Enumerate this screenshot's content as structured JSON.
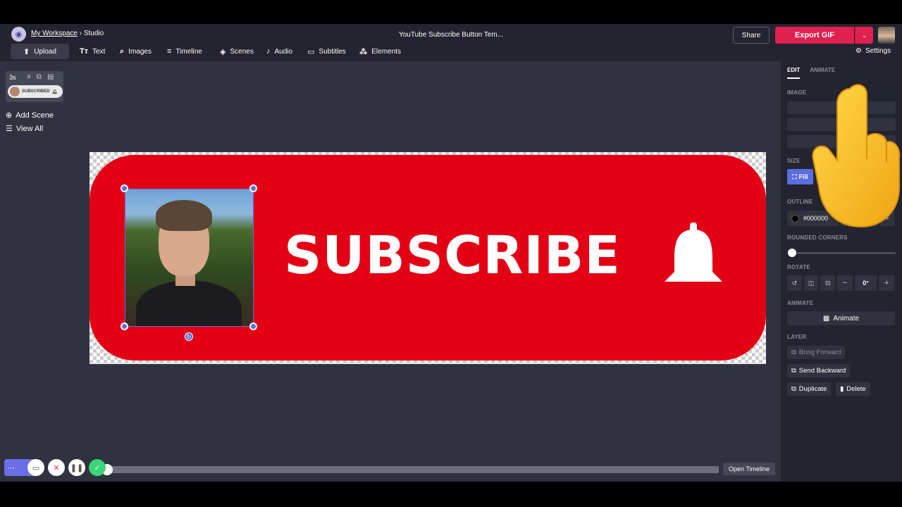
{
  "header": {
    "workspace_link": "My Workspace",
    "separator": "›",
    "section": "Studio",
    "doc_title": "YouTube Subscribe Button Tem...",
    "share_label": "Share",
    "export_label": "Export GIF",
    "export_caret": "⌄"
  },
  "toolbar": {
    "upload": "Upload",
    "text": "Text",
    "images": "Images",
    "timeline": "Timeline",
    "scenes": "Scenes",
    "audio": "Audio",
    "subtitles": "Subtitles",
    "elements": "Elements",
    "settings": "Settings"
  },
  "scenes": {
    "duration": "3s",
    "thumb_label": "SUBSCRIBED",
    "add_scene": "Add Scene",
    "view_all": "View All"
  },
  "canvas": {
    "subscribe_text": "SUBSCRIBE"
  },
  "bottom": {
    "open_timeline": "Open Timeline",
    "progress": 0.0
  },
  "panel": {
    "tab_edit": "EDIT",
    "tab_animate": "ANIMATE",
    "image_label": "IMAGE",
    "size_label": "SIZE",
    "fill_label": "Fill",
    "outline_label": "OUTLINE",
    "outline_color": "#000000",
    "outline_width": "0",
    "rounded_label": "ROUNDED CORNERS",
    "rounded_value": 0,
    "rotate_label": "ROTATE",
    "rotate_value": "0°",
    "animate_section": "ANIMATE",
    "animate_btn": "Animate",
    "layer_label": "LAYER",
    "bring_forward": "Bring Forward",
    "send_backward": "Send Backward",
    "duplicate": "Duplicate",
    "delete": "Delete"
  },
  "colors": {
    "accent": "#e0204e",
    "selection": "#5a6ee0",
    "banner_red": "#e40014"
  }
}
